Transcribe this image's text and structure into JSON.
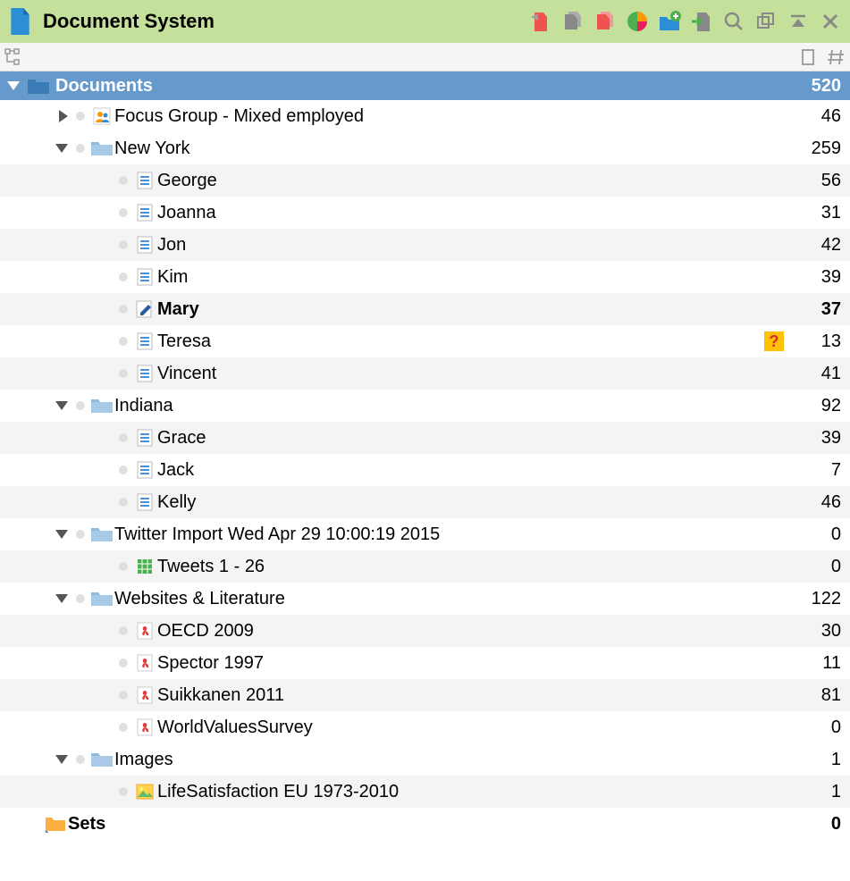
{
  "header": {
    "title": "Document System"
  },
  "root": {
    "label": "Documents",
    "count": "520"
  },
  "tree": [
    {
      "id": "focus",
      "indent": 0,
      "expander": "right",
      "icon": "group",
      "label": "Focus Group - Mixed employed",
      "count": "46",
      "bold": false,
      "badge": null,
      "striped": false
    },
    {
      "id": "ny",
      "indent": 0,
      "expander": "down",
      "icon": "folder-blue",
      "label": "New York",
      "count": "259",
      "bold": false,
      "badge": null,
      "striped": false
    },
    {
      "id": "george",
      "indent": 1,
      "expander": "",
      "icon": "doc",
      "label": "George",
      "count": "56",
      "bold": false,
      "badge": null,
      "striped": true
    },
    {
      "id": "joanna",
      "indent": 1,
      "expander": "",
      "icon": "doc",
      "label": "Joanna",
      "count": "31",
      "bold": false,
      "badge": null,
      "striped": false
    },
    {
      "id": "jon",
      "indent": 1,
      "expander": "",
      "icon": "doc",
      "label": "Jon",
      "count": "42",
      "bold": false,
      "badge": null,
      "striped": true
    },
    {
      "id": "kim",
      "indent": 1,
      "expander": "",
      "icon": "doc",
      "label": "Kim",
      "count": "39",
      "bold": false,
      "badge": null,
      "striped": false
    },
    {
      "id": "mary",
      "indent": 1,
      "expander": "",
      "icon": "edit",
      "label": "Mary",
      "count": "37",
      "bold": true,
      "badge": null,
      "striped": true
    },
    {
      "id": "teresa",
      "indent": 1,
      "expander": "",
      "icon": "doc",
      "label": "Teresa",
      "count": "13",
      "bold": false,
      "badge": "question",
      "striped": false
    },
    {
      "id": "vincent",
      "indent": 1,
      "expander": "",
      "icon": "doc",
      "label": "Vincent",
      "count": "41",
      "bold": false,
      "badge": null,
      "striped": true
    },
    {
      "id": "indiana",
      "indent": 0,
      "expander": "down",
      "icon": "folder-blue",
      "label": "Indiana",
      "count": "92",
      "bold": false,
      "badge": null,
      "striped": false
    },
    {
      "id": "grace",
      "indent": 1,
      "expander": "",
      "icon": "doc",
      "label": "Grace",
      "count": "39",
      "bold": false,
      "badge": null,
      "striped": true
    },
    {
      "id": "jack",
      "indent": 1,
      "expander": "",
      "icon": "doc",
      "label": "Jack",
      "count": "7",
      "bold": false,
      "badge": null,
      "striped": false
    },
    {
      "id": "kelly",
      "indent": 1,
      "expander": "",
      "icon": "doc",
      "label": "Kelly",
      "count": "46",
      "bold": false,
      "badge": null,
      "striped": true
    },
    {
      "id": "twitter",
      "indent": 0,
      "expander": "down",
      "icon": "folder-blue",
      "label": "Twitter Import Wed Apr 29 10:00:19 2015",
      "count": "0",
      "bold": false,
      "badge": null,
      "striped": false
    },
    {
      "id": "tweets",
      "indent": 1,
      "expander": "",
      "icon": "table",
      "label": "Tweets 1 - 26",
      "count": "0",
      "bold": false,
      "badge": null,
      "striped": true
    },
    {
      "id": "websites",
      "indent": 0,
      "expander": "down",
      "icon": "folder-blue",
      "label": "Websites & Literature",
      "count": "122",
      "bold": false,
      "badge": null,
      "striped": false
    },
    {
      "id": "oecd",
      "indent": 1,
      "expander": "",
      "icon": "pdf",
      "label": "OECD 2009",
      "count": "30",
      "bold": false,
      "badge": null,
      "striped": true
    },
    {
      "id": "spector",
      "indent": 1,
      "expander": "",
      "icon": "pdf",
      "label": "Spector 1997",
      "count": "11",
      "bold": false,
      "badge": null,
      "striped": false
    },
    {
      "id": "suikkanen",
      "indent": 1,
      "expander": "",
      "icon": "pdf",
      "label": "Suikkanen 2011",
      "count": "81",
      "bold": false,
      "badge": null,
      "striped": true
    },
    {
      "id": "wvs",
      "indent": 1,
      "expander": "",
      "icon": "pdf",
      "label": "WorldValuesSurvey",
      "count": "0",
      "bold": false,
      "badge": null,
      "striped": false
    },
    {
      "id": "images",
      "indent": 0,
      "expander": "down",
      "icon": "folder-blue",
      "label": "Images",
      "count": "1",
      "bold": false,
      "badge": null,
      "striped": false
    },
    {
      "id": "lifesat",
      "indent": 1,
      "expander": "",
      "icon": "image",
      "label": "LifeSatisfaction EU 1973-2010",
      "count": "1",
      "bold": false,
      "badge": null,
      "striped": true
    }
  ],
  "sets": {
    "label": "Sets",
    "count": "0"
  }
}
